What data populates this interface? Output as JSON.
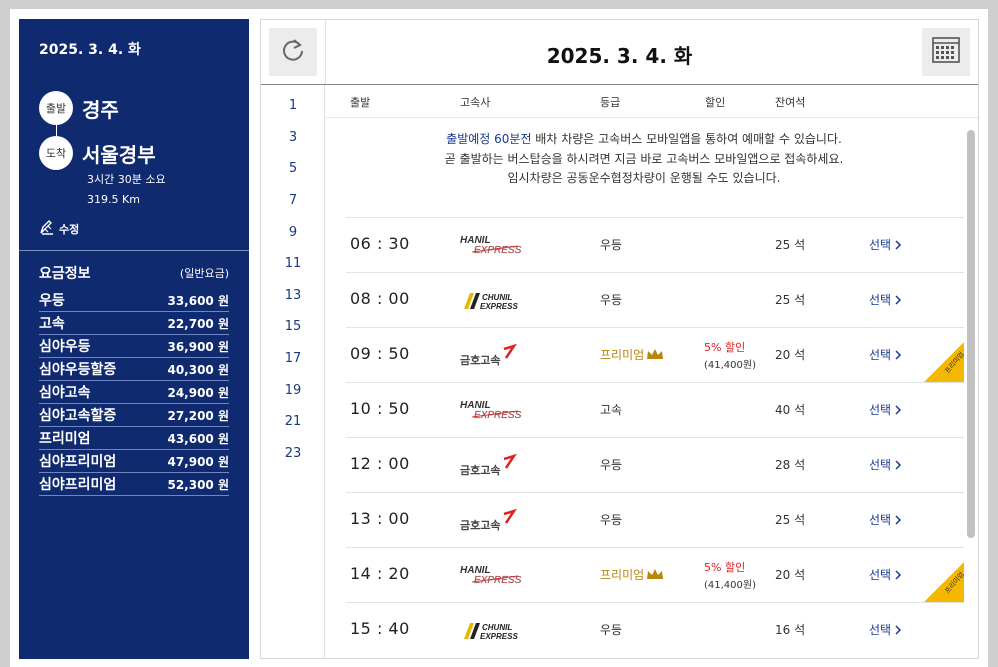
{
  "summary": {
    "date": "2025. 3. 4. 화",
    "departure_badge": "출발",
    "departure": "경주",
    "arrival_badge": "도착",
    "arrival": "서울경부",
    "duration": "3시간 30분 소요",
    "distance": "319.5 Km",
    "edit_label": "수정"
  },
  "fare_info": {
    "title": "요금정보",
    "subtitle": "(일반요금)",
    "items": [
      {
        "name": "우등",
        "price": "33,600 원"
      },
      {
        "name": "고속",
        "price": "22,700 원"
      },
      {
        "name": "심야우등",
        "price": "36,900 원"
      },
      {
        "name": "심야우등할증",
        "price": "40,300 원"
      },
      {
        "name": "심야고속",
        "price": "24,900 원"
      },
      {
        "name": "심야고속할증",
        "price": "27,200 원"
      },
      {
        "name": "프리미엄",
        "price": "43,600 원"
      },
      {
        "name": "심야프리미엄",
        "price": "47,900 원"
      },
      {
        "name": "심야프리미엄",
        "price": "52,300 원"
      }
    ]
  },
  "header": {
    "title": "2025. 3. 4. 화"
  },
  "hours": [
    "1",
    "3",
    "5",
    "7",
    "9",
    "11",
    "13",
    "15",
    "17",
    "19",
    "21",
    "23"
  ],
  "columns": {
    "departure": "출발",
    "company": "고속사",
    "grade": "등급",
    "discount": "할인",
    "seats": "잔여석"
  },
  "notice": {
    "highlight": "출발예정 60분전",
    "line1_rest": " 배차 차량은 고속버스 모바일앱을 통하여 예매할 수 있습니다.",
    "line2": "곧 출발하는 버스탑승을 하시려면 지금 바로 고속버스 모바일앱으로 접속하세요.",
    "line3": "임시차량은 공동운수협정차량이 운행될 수도 있습니다."
  },
  "schedules": [
    {
      "time": "06 : 30",
      "company": "hanil",
      "company_text": "HANIL EXPRESS",
      "grade": "우등",
      "premium": false,
      "discount": "",
      "discount_price": "",
      "seats": "25 석",
      "select": "선택"
    },
    {
      "time": "08 : 00",
      "company": "chunil",
      "company_text": "CHUNIL EXPRESS",
      "grade": "우등",
      "premium": false,
      "discount": "",
      "discount_price": "",
      "seats": "25 석",
      "select": "선택"
    },
    {
      "time": "09 : 50",
      "company": "kumho",
      "company_text": "금호고속",
      "grade": "프리미엄",
      "premium": true,
      "discount": "5% 할인",
      "discount_price": "(41,400원)",
      "seats": "20 석",
      "select": "선택"
    },
    {
      "time": "10 : 50",
      "company": "hanil",
      "company_text": "HANIL EXPRESS",
      "grade": "고속",
      "premium": false,
      "discount": "",
      "discount_price": "",
      "seats": "40 석",
      "select": "선택"
    },
    {
      "time": "12 : 00",
      "company": "kumho",
      "company_text": "금호고속",
      "grade": "우등",
      "premium": false,
      "discount": "",
      "discount_price": "",
      "seats": "28 석",
      "select": "선택"
    },
    {
      "time": "13 : 00",
      "company": "kumho",
      "company_text": "금호고속",
      "grade": "우등",
      "premium": false,
      "discount": "",
      "discount_price": "",
      "seats": "25 석",
      "select": "선택"
    },
    {
      "time": "14 : 20",
      "company": "hanil",
      "company_text": "HANIL EXPRESS",
      "grade": "프리미엄",
      "premium": true,
      "discount": "5% 할인",
      "discount_price": "(41,400원)",
      "seats": "20 석",
      "select": "선택"
    },
    {
      "time": "15 : 40",
      "company": "chunil",
      "company_text": "CHUNIL EXPRESS",
      "grade": "우등",
      "premium": false,
      "discount": "",
      "discount_price": "",
      "seats": "16 석",
      "select": "선택"
    }
  ],
  "premium_ribbon": "프리미엄",
  "colors": {
    "sidebar": "#0f2a6f",
    "accent_link": "#1a3a8f",
    "premium": "#b8860b",
    "discount": "#e02020",
    "ribbon": "#f5b800"
  }
}
